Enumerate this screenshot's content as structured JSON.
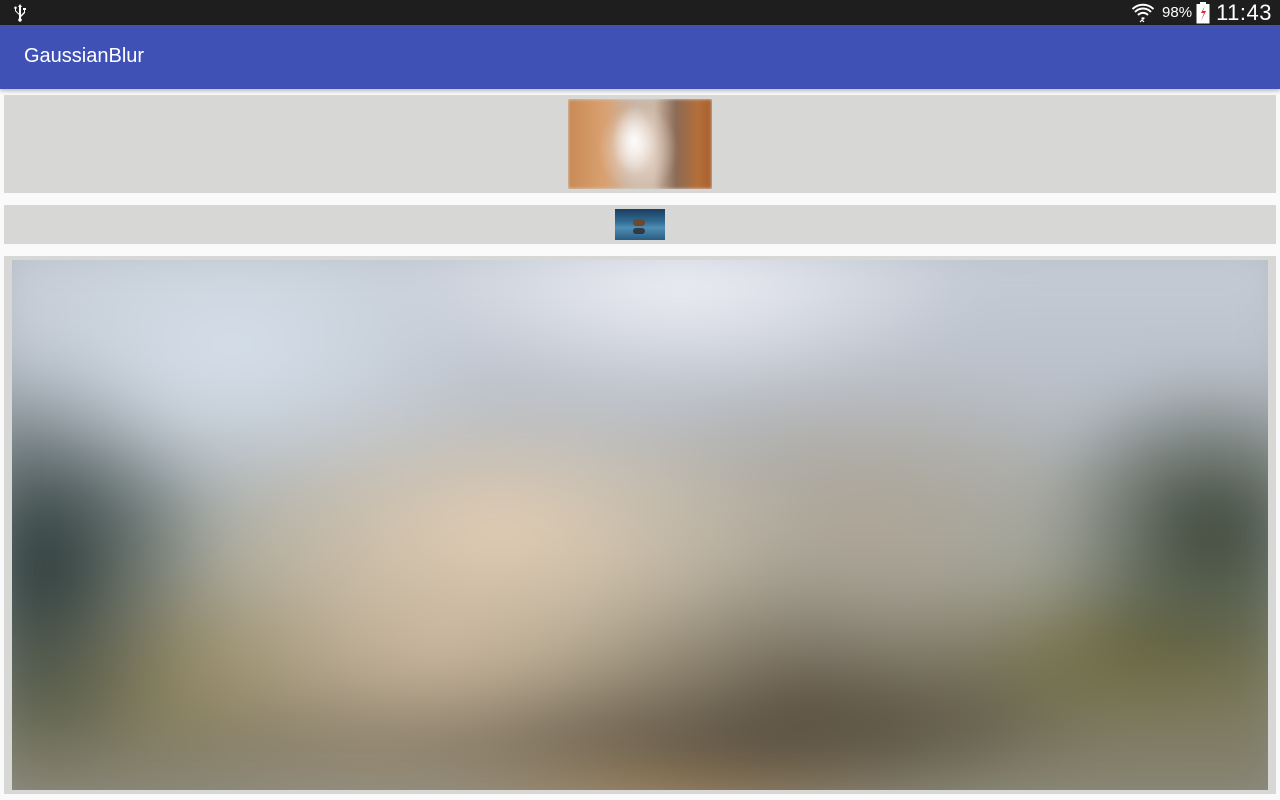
{
  "status_bar": {
    "battery_percent": "98%",
    "time": "11:43",
    "icons": [
      "usb-icon",
      "wifi-icon",
      "battery-icon"
    ]
  },
  "app_bar": {
    "title": "GaussianBlur",
    "color": "#3f51b5"
  },
  "images": [
    {
      "name": "blurred-image-small",
      "description_icon": "image"
    },
    {
      "name": "original-thumbnail",
      "description_icon": "image"
    },
    {
      "name": "blurred-image-large",
      "description_icon": "image"
    }
  ]
}
